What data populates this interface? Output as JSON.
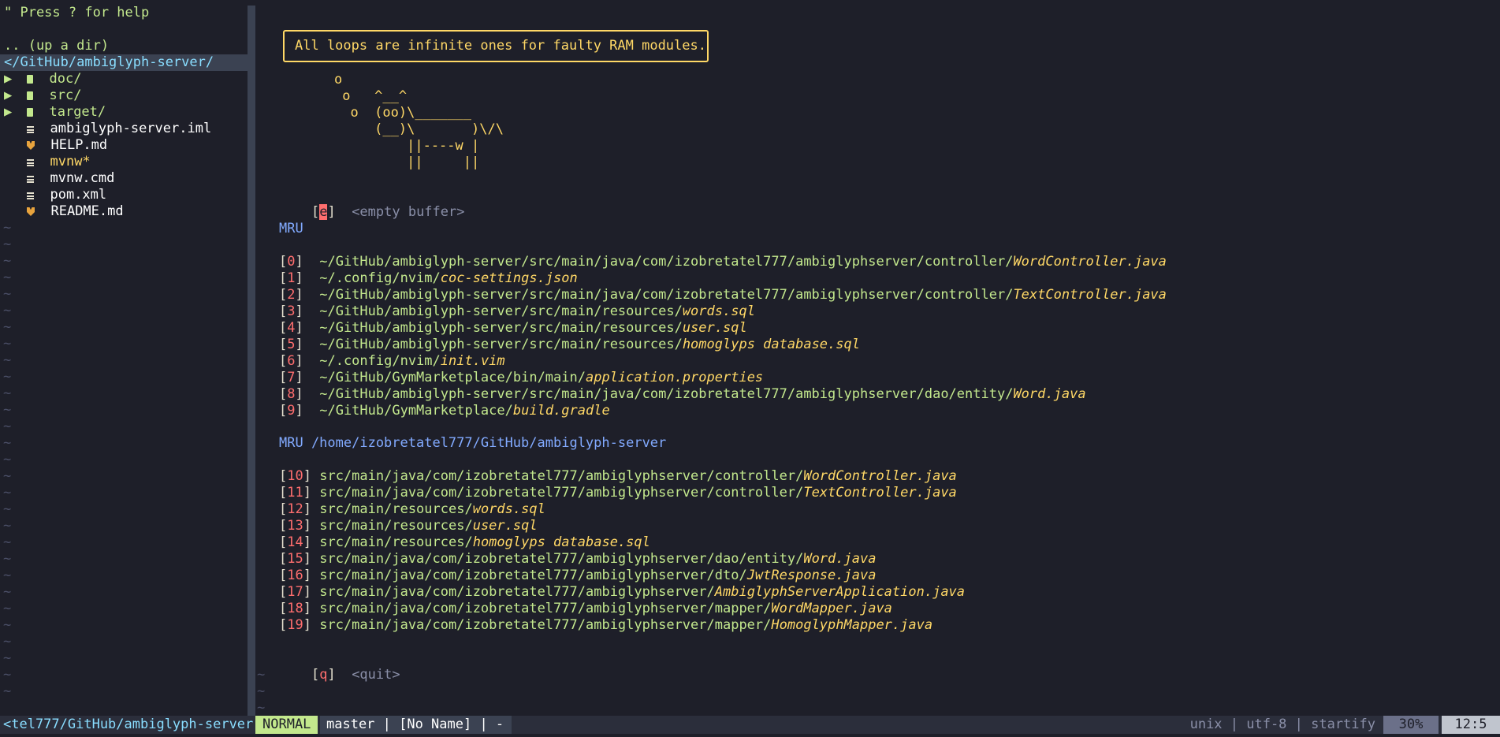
{
  "tree": {
    "help": "\" Press ? for help",
    "updir": ".. (up a dir)",
    "cwd": "</GitHub/ambiglyph-server/",
    "entries": [
      {
        "arrow": "▶",
        "icon": "folder",
        "name": "doc/"
      },
      {
        "arrow": "▶",
        "icon": "folder",
        "name": "src/"
      },
      {
        "arrow": "▶",
        "icon": "folder",
        "name": "target/"
      },
      {
        "arrow": "",
        "icon": "doc",
        "name": "ambiglyph-server.iml"
      },
      {
        "arrow": "",
        "icon": "markdown",
        "name": "HELP.md"
      },
      {
        "arrow": "",
        "icon": "doc",
        "name": "mvnw*"
      },
      {
        "arrow": "",
        "icon": "doc",
        "name": "mvnw.cmd"
      },
      {
        "arrow": "",
        "icon": "doc",
        "name": "pom.xml"
      },
      {
        "arrow": "",
        "icon": "markdown",
        "name": "README.md"
      }
    ],
    "tilde": "~"
  },
  "startify": {
    "quote": "All loops are infinite ones for faulty RAM modules.",
    "cow": [
      "o",
      " o   ^__^",
      "  o  (oo)\\_______",
      "     (__)\\       )\\/\\",
      "         ||----w |",
      "         ||     ||"
    ],
    "empty": {
      "key": "e",
      "label": "<empty buffer>"
    },
    "mru_header": "MRU",
    "mru": [
      {
        "idx": "0",
        "dir": "~/GitHub/ambiglyph-server/src/main/java/com/izobretatel777/ambiglyphserver/controller/",
        "file": "WordController.java"
      },
      {
        "idx": "1",
        "dir": "~/.config/nvim/",
        "file": "coc-settings.json"
      },
      {
        "idx": "2",
        "dir": "~/GitHub/ambiglyph-server/src/main/java/com/izobretatel777/ambiglyphserver/controller/",
        "file": "TextController.java"
      },
      {
        "idx": "3",
        "dir": "~/GitHub/ambiglyph-server/src/main/resources/",
        "file": "words.sql"
      },
      {
        "idx": "4",
        "dir": "~/GitHub/ambiglyph-server/src/main/resources/",
        "file": "user.sql"
      },
      {
        "idx": "5",
        "dir": "~/GitHub/ambiglyph-server/src/main/resources/",
        "file": "homoglyps database.sql"
      },
      {
        "idx": "6",
        "dir": "~/.config/nvim/",
        "file": "init.vim"
      },
      {
        "idx": "7",
        "dir": "~/GitHub/GymMarketplace/bin/main/",
        "file": "application.properties"
      },
      {
        "idx": "8",
        "dir": "~/GitHub/ambiglyph-server/src/main/java/com/izobretatel777/ambiglyphserver/dao/entity/",
        "file": "Word.java"
      },
      {
        "idx": "9",
        "dir": "~/GitHub/GymMarketplace/",
        "file": "build.gradle"
      }
    ],
    "mru_dir_header": "MRU /home/izobretatel777/GitHub/ambiglyph-server",
    "mru_dir": [
      {
        "idx": "10",
        "dir": "src/main/java/com/izobretatel777/ambiglyphserver/controller/",
        "file": "WordController.java"
      },
      {
        "idx": "11",
        "dir": "src/main/java/com/izobretatel777/ambiglyphserver/controller/",
        "file": "TextController.java"
      },
      {
        "idx": "12",
        "dir": "src/main/resources/",
        "file": "words.sql"
      },
      {
        "idx": "13",
        "dir": "src/main/resources/",
        "file": "user.sql"
      },
      {
        "idx": "14",
        "dir": "src/main/resources/",
        "file": "homoglyps database.sql"
      },
      {
        "idx": "15",
        "dir": "src/main/java/com/izobretatel777/ambiglyphserver/dao/entity/",
        "file": "Word.java"
      },
      {
        "idx": "16",
        "dir": "src/main/java/com/izobretatel777/ambiglyphserver/dto/",
        "file": "JwtResponse.java"
      },
      {
        "idx": "17",
        "dir": "src/main/java/com/izobretatel777/ambiglyphserver/",
        "file": "AmbiglyphServerApplication.java"
      },
      {
        "idx": "18",
        "dir": "src/main/java/com/izobretatel777/ambiglyphserver/mapper/",
        "file": "WordMapper.java"
      },
      {
        "idx": "19",
        "dir": "src/main/java/com/izobretatel777/ambiglyphserver/mapper/",
        "file": "HomoglyphMapper.java"
      }
    ],
    "quit": {
      "key": "q",
      "label": "<quit>"
    }
  },
  "statusbar": {
    "left": "<tel777/GitHub/ambiglyph-server",
    "mode": "NORMAL",
    "info": "master | [No Name] | -",
    "right": "unix | utf-8 | startify",
    "percent": "30%",
    "position": "12:5"
  },
  "colors": {
    "background": "#1e1f29",
    "green": "#c3e88d",
    "yellow": "#ffd866",
    "red": "#ff6e6e",
    "blue": "#82aaff",
    "mode_bg": "#c3e88d"
  }
}
